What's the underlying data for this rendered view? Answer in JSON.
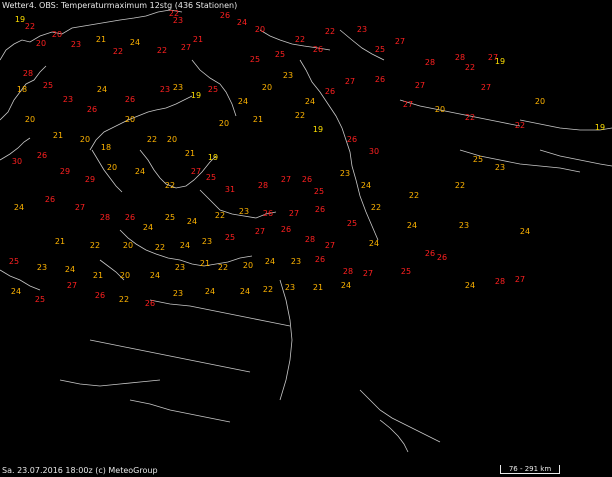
{
  "title": "Wetter4. OBS: Temperaturmaximum 12stg (436 Stationen)",
  "footer": "Sa. 23.07.2016 18:00z (c) MeteoGroup",
  "scale_label": "76 - 291 km",
  "colors": {
    "warm": "#ffb400",
    "hot": "#ff2020",
    "mild": "#ffe000",
    "border": "#c8c8c8"
  },
  "observations": [
    {
      "v": 22,
      "c": "hot"
    },
    {
      "v": 19,
      "c": "mild"
    },
    {
      "v": 20,
      "c": "hot"
    },
    {
      "v": 22,
      "c": "hot"
    },
    {
      "v": 20,
      "c": "hot"
    },
    {
      "v": 23,
      "c": "hot"
    },
    {
      "v": 21,
      "c": "warm"
    },
    {
      "v": 22,
      "c": "hot"
    },
    {
      "v": 24,
      "c": "warm"
    },
    {
      "v": 22,
      "c": "hot"
    },
    {
      "v": 27,
      "c": "hot"
    },
    {
      "v": 23,
      "c": "hot"
    },
    {
      "v": 21,
      "c": "hot"
    },
    {
      "v": 26,
      "c": "hot"
    },
    {
      "v": 24,
      "c": "hot"
    },
    {
      "v": 20,
      "c": "hot"
    },
    {
      "v": 25,
      "c": "hot"
    },
    {
      "v": 25,
      "c": "hot"
    },
    {
      "v": 22,
      "c": "hot"
    },
    {
      "v": 26,
      "c": "hot"
    },
    {
      "v": 22,
      "c": "hot"
    },
    {
      "v": 23,
      "c": "hot"
    },
    {
      "v": 25,
      "c": "hot"
    },
    {
      "v": 27,
      "c": "hot"
    },
    {
      "v": 28,
      "c": "hot"
    },
    {
      "v": 28,
      "c": "hot"
    },
    {
      "v": 27,
      "c": "hot"
    },
    {
      "v": 22,
      "c": "hot"
    },
    {
      "v": 19,
      "c": "mild"
    },
    {
      "v": 28,
      "c": "hot"
    },
    {
      "v": 25,
      "c": "hot"
    },
    {
      "v": 23,
      "c": "hot"
    },
    {
      "v": 18,
      "c": "warm"
    },
    {
      "v": 26,
      "c": "hot"
    },
    {
      "v": 24,
      "c": "warm"
    },
    {
      "v": 26,
      "c": "hot"
    },
    {
      "v": 23,
      "c": "hot"
    },
    {
      "v": 23,
      "c": "warm"
    },
    {
      "v": 19,
      "c": "mild"
    },
    {
      "v": 25,
      "c": "hot"
    },
    {
      "v": 24,
      "c": "warm"
    },
    {
      "v": 20,
      "c": "warm"
    },
    {
      "v": 23,
      "c": "warm"
    },
    {
      "v": 24,
      "c": "warm"
    },
    {
      "v": 26,
      "c": "hot"
    },
    {
      "v": 27,
      "c": "hot"
    },
    {
      "v": 26,
      "c": "hot"
    },
    {
      "v": 27,
      "c": "hot"
    },
    {
      "v": 27,
      "c": "hot"
    },
    {
      "v": 20,
      "c": "warm"
    },
    {
      "v": 27,
      "c": "hot"
    },
    {
      "v": 20,
      "c": "warm"
    },
    {
      "v": 22,
      "c": "hot"
    },
    {
      "v": 22,
      "c": "hot"
    },
    {
      "v": 19,
      "c": "mild"
    },
    {
      "v": 20,
      "c": "warm"
    },
    {
      "v": 21,
      "c": "warm"
    },
    {
      "v": 20,
      "c": "warm"
    },
    {
      "v": 18,
      "c": "warm"
    },
    {
      "v": 20,
      "c": "warm"
    },
    {
      "v": 22,
      "c": "warm"
    },
    {
      "v": 20,
      "c": "warm"
    },
    {
      "v": 21,
      "c": "warm"
    },
    {
      "v": 19,
      "c": "mild"
    },
    {
      "v": 20,
      "c": "warm"
    },
    {
      "v": 21,
      "c": "warm"
    },
    {
      "v": 22,
      "c": "warm"
    },
    {
      "v": 19,
      "c": "mild"
    },
    {
      "v": 26,
      "c": "hot"
    },
    {
      "v": 30,
      "c": "hot"
    },
    {
      "v": 30,
      "c": "hot"
    },
    {
      "v": 26,
      "c": "hot"
    },
    {
      "v": 29,
      "c": "hot"
    },
    {
      "v": 29,
      "c": "hot"
    },
    {
      "v": 20,
      "c": "warm"
    },
    {
      "v": 24,
      "c": "warm"
    },
    {
      "v": 22,
      "c": "warm"
    },
    {
      "v": 27,
      "c": "hot"
    },
    {
      "v": 25,
      "c": "hot"
    },
    {
      "v": 31,
      "c": "hot"
    },
    {
      "v": 28,
      "c": "hot"
    },
    {
      "v": 27,
      "c": "hot"
    },
    {
      "v": 26,
      "c": "hot"
    },
    {
      "v": 25,
      "c": "hot"
    },
    {
      "v": 23,
      "c": "warm"
    },
    {
      "v": 24,
      "c": "warm"
    },
    {
      "v": 22,
      "c": "warm"
    },
    {
      "v": 22,
      "c": "warm"
    },
    {
      "v": 22,
      "c": "warm"
    },
    {
      "v": 25,
      "c": "warm"
    },
    {
      "v": 23,
      "c": "warm"
    },
    {
      "v": 24,
      "c": "warm"
    },
    {
      "v": 26,
      "c": "hot"
    },
    {
      "v": 27,
      "c": "hot"
    },
    {
      "v": 28,
      "c": "hot"
    },
    {
      "v": 26,
      "c": "hot"
    },
    {
      "v": 24,
      "c": "warm"
    },
    {
      "v": 25,
      "c": "warm"
    },
    {
      "v": 24,
      "c": "warm"
    },
    {
      "v": 22,
      "c": "warm"
    },
    {
      "v": 23,
      "c": "warm"
    },
    {
      "v": 26,
      "c": "hot"
    },
    {
      "v": 27,
      "c": "hot"
    },
    {
      "v": 26,
      "c": "hot"
    },
    {
      "v": 25,
      "c": "hot"
    },
    {
      "v": 24,
      "c": "warm"
    },
    {
      "v": 24,
      "c": "warm"
    },
    {
      "v": 23,
      "c": "warm"
    },
    {
      "v": 24,
      "c": "warm"
    },
    {
      "v": 21,
      "c": "warm"
    },
    {
      "v": 22,
      "c": "warm"
    },
    {
      "v": 20,
      "c": "warm"
    },
    {
      "v": 22,
      "c": "warm"
    },
    {
      "v": 24,
      "c": "warm"
    },
    {
      "v": 23,
      "c": "warm"
    },
    {
      "v": 25,
      "c": "hot"
    },
    {
      "v": 27,
      "c": "hot"
    },
    {
      "v": 26,
      "c": "hot"
    },
    {
      "v": 28,
      "c": "hot"
    },
    {
      "v": 27,
      "c": "hot"
    },
    {
      "v": 25,
      "c": "hot"
    },
    {
      "v": 23,
      "c": "warm"
    },
    {
      "v": 24,
      "c": "warm"
    },
    {
      "v": 21,
      "c": "warm"
    },
    {
      "v": 20,
      "c": "warm"
    },
    {
      "v": 24,
      "c": "warm"
    },
    {
      "v": 23,
      "c": "warm"
    },
    {
      "v": 21,
      "c": "warm"
    },
    {
      "v": 22,
      "c": "warm"
    },
    {
      "v": 20,
      "c": "warm"
    },
    {
      "v": 24,
      "c": "warm"
    },
    {
      "v": 23,
      "c": "warm"
    },
    {
      "v": 26,
      "c": "hot"
    },
    {
      "v": 28,
      "c": "hot"
    },
    {
      "v": 27,
      "c": "hot"
    },
    {
      "v": 25,
      "c": "hot"
    },
    {
      "v": 26,
      "c": "hot"
    },
    {
      "v": 26,
      "c": "hot"
    },
    {
      "v": 24,
      "c": "warm"
    },
    {
      "v": 28,
      "c": "hot"
    },
    {
      "v": 27,
      "c": "hot"
    },
    {
      "v": 24,
      "c": "warm"
    },
    {
      "v": 25,
      "c": "hot"
    },
    {
      "v": 27,
      "c": "hot"
    },
    {
      "v": 26,
      "c": "hot"
    },
    {
      "v": 22,
      "c": "warm"
    },
    {
      "v": 26,
      "c": "hot"
    },
    {
      "v": 23,
      "c": "warm"
    },
    {
      "v": 24,
      "c": "warm"
    },
    {
      "v": 24,
      "c": "warm"
    },
    {
      "v": 22,
      "c": "warm"
    },
    {
      "v": 23,
      "c": "warm"
    },
    {
      "v": 21,
      "c": "warm"
    },
    {
      "v": 24,
      "c": "warm"
    }
  ]
}
